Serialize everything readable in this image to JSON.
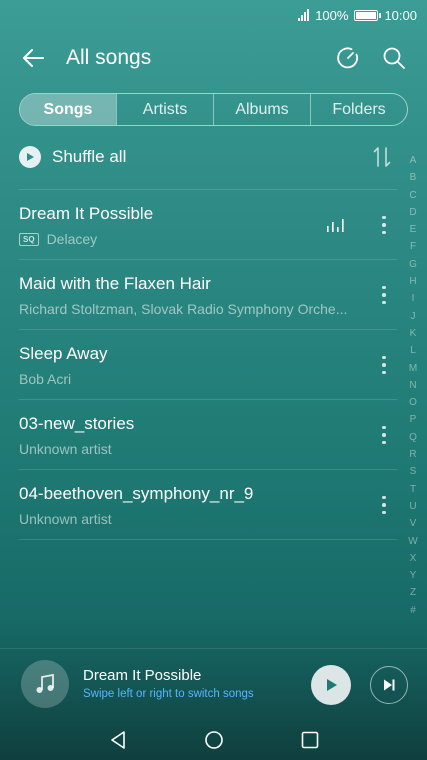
{
  "status_bar": {
    "battery_percent": "100%",
    "time": "10:00"
  },
  "header": {
    "title": "All songs"
  },
  "tabs": [
    {
      "label": "Songs",
      "active": true
    },
    {
      "label": "Artists",
      "active": false
    },
    {
      "label": "Albums",
      "active": false
    },
    {
      "label": "Folders",
      "active": false
    }
  ],
  "shuffle": {
    "label": "Shuffle all"
  },
  "songs": [
    {
      "title": "Dream It Possible",
      "artist": "Delacey",
      "badge": "SQ",
      "playing": true
    },
    {
      "title": "Maid with the Flaxen Hair",
      "artist": "Richard Stoltzman, Slovak Radio Symphony Orche...",
      "playing": false
    },
    {
      "title": "Sleep Away",
      "artist": "Bob Acri",
      "playing": false
    },
    {
      "title": "03-new_stories",
      "artist": "Unknown artist",
      "playing": false
    },
    {
      "title": "04-beethoven_symphony_nr_9",
      "artist": "Unknown artist",
      "playing": false
    }
  ],
  "alpha_index": [
    "A",
    "B",
    "C",
    "D",
    "E",
    "F",
    "G",
    "H",
    "I",
    "J",
    "K",
    "L",
    "M",
    "N",
    "O",
    "P",
    "Q",
    "R",
    "S",
    "T",
    "U",
    "V",
    "W",
    "X",
    "Y",
    "Z",
    "#"
  ],
  "now_playing": {
    "title": "Dream It Possible",
    "hint": "Swipe left or right to switch songs"
  },
  "colors": {
    "accent_hint": "#58b4ff",
    "background_top": "#3c9c96",
    "background_bottom": "#0f3f3e"
  },
  "icons": {
    "back": "arrow-left-icon",
    "sleep_timer": "timer-icon",
    "search": "search-icon",
    "shuffle_play": "play-icon",
    "sort": "sort-icon",
    "equalizer": "equalizer-icon",
    "more": "more-vertical-icon",
    "album_art": "music-note-icon",
    "play": "play-icon",
    "next": "skip-next-icon",
    "nav_back": "triangle-back-icon",
    "nav_home": "circle-home-icon",
    "nav_recent": "square-recents-icon"
  }
}
